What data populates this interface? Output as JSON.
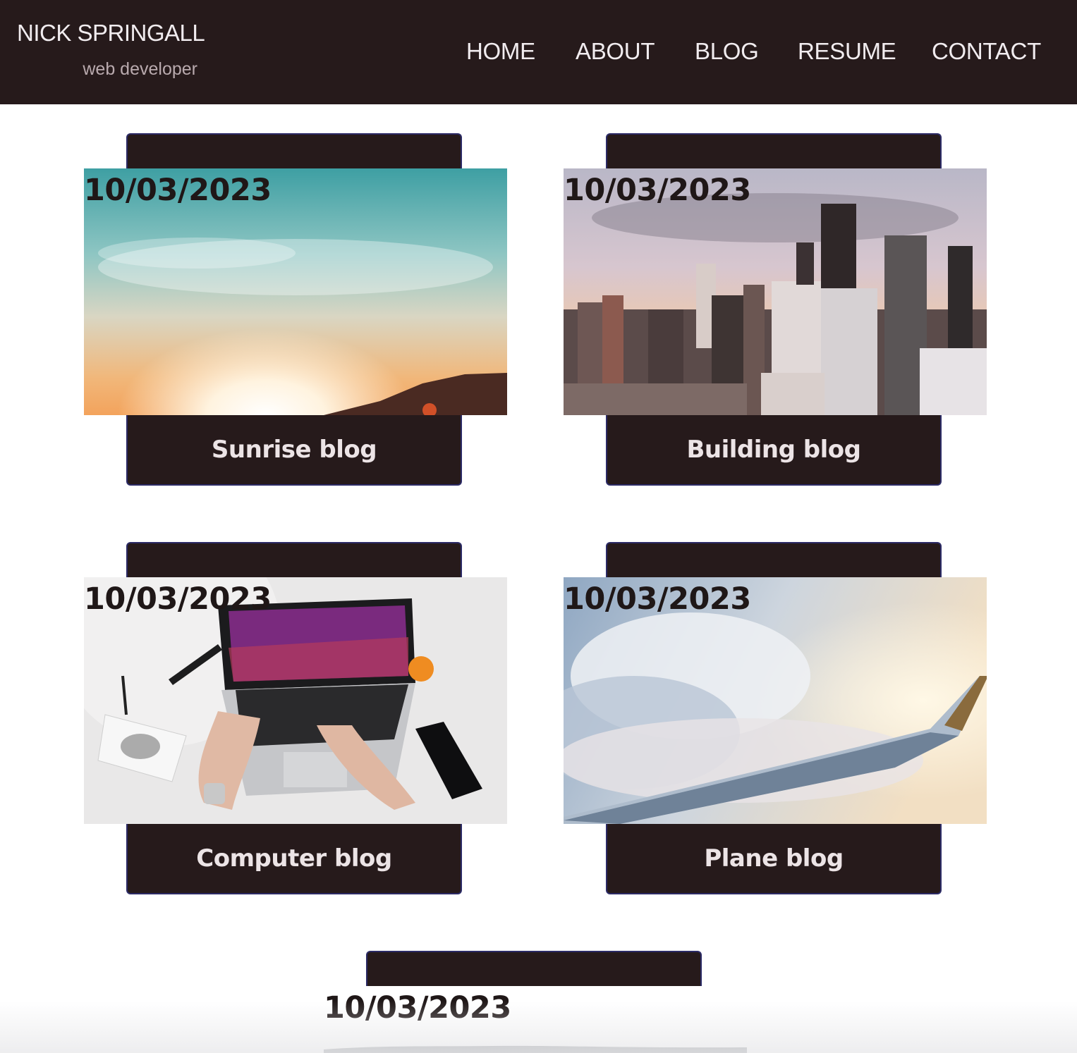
{
  "brand": {
    "name": "NICK SPRINGALL",
    "tagline": "web developer"
  },
  "nav": {
    "items": [
      {
        "label": "HOME"
      },
      {
        "label": "ABOUT"
      },
      {
        "label": "BLOG"
      },
      {
        "label": "RESUME"
      },
      {
        "label": "CONTACT"
      }
    ]
  },
  "posts": [
    {
      "date": "10/03/2023",
      "title": "Sunrise blog"
    },
    {
      "date": "10/03/2023",
      "title": "Building blog"
    },
    {
      "date": "10/03/2023",
      "title": "Computer blog"
    },
    {
      "date": "10/03/2023",
      "title": "Plane blog"
    },
    {
      "date": "10/03/2023",
      "title": ""
    }
  ],
  "colors": {
    "header_bg": "#261a1b",
    "card_border": "#2c2b66",
    "nav_text": "#f1ecef"
  }
}
